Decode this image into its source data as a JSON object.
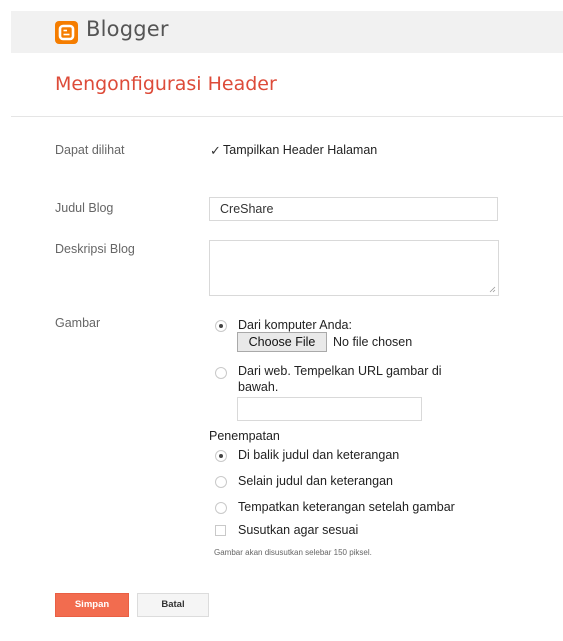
{
  "app": {
    "brand": "Blogger"
  },
  "page": {
    "title": "Mengonfigurasi Header"
  },
  "visible": {
    "label": "Dapat dilihat",
    "checkbox_mark": "✓",
    "checkbox_label": "Tampilkan Header Halaman",
    "checked": true
  },
  "blog_title": {
    "label": "Judul Blog",
    "value": "CreShare"
  },
  "blog_description": {
    "label": "Deskripsi Blog",
    "value": ""
  },
  "image": {
    "label": "Gambar",
    "from_computer": {
      "label": "Dari komputer Anda:",
      "selected": true
    },
    "file_button": "Choose File",
    "file_status": "No file chosen",
    "from_web": {
      "label_line1": "Dari web. Tempelkan URL gambar di",
      "label_line2": "bawah.",
      "selected": false
    },
    "url_value": ""
  },
  "placement": {
    "label": "Penempatan",
    "options": [
      {
        "label": "Di balik judul dan keterangan",
        "selected": true
      },
      {
        "label": "Selain judul dan keterangan",
        "selected": false
      },
      {
        "label": "Tempatkan keterangan setelah gambar",
        "selected": false
      }
    ],
    "shrink": {
      "label": "Susutkan agar sesuai",
      "checked": false
    },
    "note": "Gambar akan disusutkan selebar 150 piksel."
  },
  "actions": {
    "save": "Simpan",
    "cancel": "Batal"
  },
  "colors": {
    "brand_orange": "#f57d00",
    "title_red": "#dd4b39",
    "save_button": "#f26c4f"
  }
}
